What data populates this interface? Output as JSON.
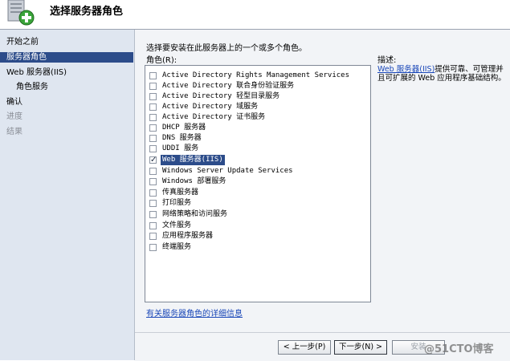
{
  "header": {
    "title": "选择服务器角色"
  },
  "nav": [
    {
      "label": "开始之前",
      "state": "normal"
    },
    {
      "label": "服务器角色",
      "state": "selected"
    },
    {
      "label": "Web 服务器(IIS)",
      "state": "normal"
    },
    {
      "label": "角色服务",
      "state": "sub"
    },
    {
      "label": "确认",
      "state": "normal"
    },
    {
      "label": "进度",
      "state": "disabled"
    },
    {
      "label": "结果",
      "state": "disabled"
    }
  ],
  "main": {
    "instruction": "选择要安装在此服务器上的一个或多个角色。",
    "roles_label": "角色(R):",
    "roles": [
      {
        "label": "Active Directory Rights Management Services",
        "checked": false
      },
      {
        "label": "Active Directory 联合身份验证服务",
        "checked": false
      },
      {
        "label": "Active Directory 轻型目录服务",
        "checked": false
      },
      {
        "label": "Active Directory 域服务",
        "checked": false
      },
      {
        "label": "Active Directory 证书服务",
        "checked": false
      },
      {
        "label": "DHCP 服务器",
        "checked": false
      },
      {
        "label": "DNS 服务器",
        "checked": false
      },
      {
        "label": "UDDI 服务",
        "checked": false
      },
      {
        "label": "Web 服务器(IIS)",
        "checked": true,
        "selected": true
      },
      {
        "label": "Windows Server Update Services",
        "checked": false
      },
      {
        "label": "Windows 部署服务",
        "checked": false
      },
      {
        "label": "传真服务器",
        "checked": false
      },
      {
        "label": "打印服务",
        "checked": false
      },
      {
        "label": "网络策略和访问服务",
        "checked": false
      },
      {
        "label": "文件服务",
        "checked": false
      },
      {
        "label": "应用程序服务器",
        "checked": false
      },
      {
        "label": "终端服务",
        "checked": false
      }
    ],
    "more_info_link": "有关服务器角色的详细信息"
  },
  "description": {
    "title": "描述:",
    "link": "Web 服务器(IIS)",
    "text": "提供可靠、可管理并且可扩展的 Web 应用程序基础结构。"
  },
  "buttons": {
    "back": "< 上一步(P)",
    "next": "下一步(N) >",
    "install": "安装"
  },
  "watermark": "@51CTO博客",
  "colors": {
    "nav_bg": "#dfe6f0",
    "selected_bg": "#2c4c8a",
    "link": "#1a47b8",
    "content_bg": "#f2f4f7"
  }
}
